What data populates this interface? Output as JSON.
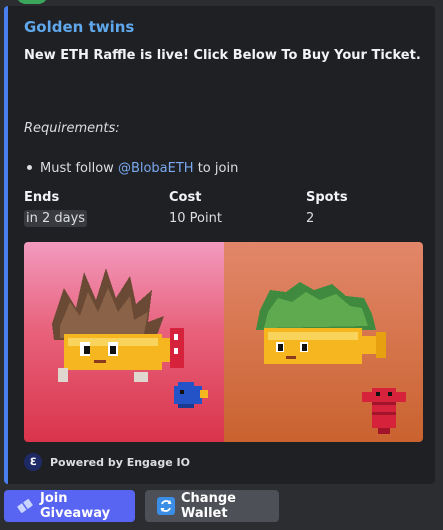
{
  "embed": {
    "title": "Golden twins",
    "description": "New ETH Raffle is live! Click Below To Buy Your Ticket.",
    "requirements_heading": "Requirements:",
    "requirement_prefix": "Must follow ",
    "requirement_mention": "@BlobaETH",
    "requirement_suffix": " to join",
    "fields": [
      {
        "name": "Ends",
        "value": "in 2 days"
      },
      {
        "name": "Cost",
        "value": "10 Point"
      },
      {
        "name": "Spots",
        "value": "2"
      }
    ],
    "footer_text": "Powered by Engage IO",
    "footer_icon": "engage-logo-icon",
    "accent_color": "#4a7ff0"
  },
  "buttons": [
    {
      "label": "Join Giveaway",
      "icon": "ticket-icon",
      "color": "#5865f2"
    },
    {
      "label": "Change Wallet",
      "icon": "refresh-icon",
      "color": "#4e5058"
    }
  ]
}
